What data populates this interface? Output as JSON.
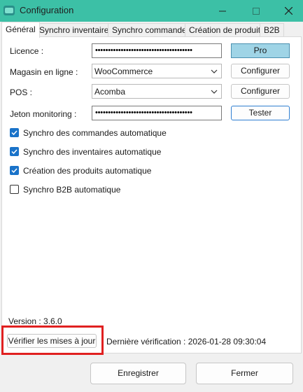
{
  "window": {
    "title": "Configuration",
    "minimize_icon": "minimize-icon",
    "maximize_icon": "maximize-icon",
    "close_icon": "close-icon"
  },
  "tabs": [
    {
      "label": "Général",
      "active": true
    },
    {
      "label": "Synchro inventaires",
      "active": false
    },
    {
      "label": "Synchro commandes",
      "active": false
    },
    {
      "label": "Création de produits",
      "active": false
    },
    {
      "label": "B2B",
      "active": false
    }
  ],
  "form": {
    "licence": {
      "label": "Licence :",
      "value": "••••••••••••••••••••••••••••••••••••••",
      "button": "Pro"
    },
    "magasin": {
      "label": "Magasin en ligne :",
      "value": "WooCommerce",
      "button": "Configurer"
    },
    "pos": {
      "label": "POS :",
      "value": "Acomba",
      "button": "Configurer"
    },
    "jeton": {
      "label": "Jeton monitoring :",
      "value": "••••••••••••••••••••••••••••••••••••••",
      "button": "Tester"
    }
  },
  "checkboxes": [
    {
      "label": "Synchro des commandes automatique",
      "checked": true
    },
    {
      "label": "Synchro des inventaires automatique",
      "checked": true
    },
    {
      "label": "Création des produits automatique",
      "checked": true
    },
    {
      "label": "Synchro B2B automatique",
      "checked": false
    }
  ],
  "footer": {
    "version": "Version : 3.6.0",
    "update_button": "Vérifier les mises à jour",
    "last_check": "Dernière vérification : 2026-01-28 09:30:04"
  },
  "actions": {
    "save": "Enregistrer",
    "close": "Fermer"
  },
  "colors": {
    "titlebar": "#3cc0a6",
    "pro_button": "#9fd4e6",
    "checkbox": "#1a73c9",
    "highlight": "#e02020"
  }
}
